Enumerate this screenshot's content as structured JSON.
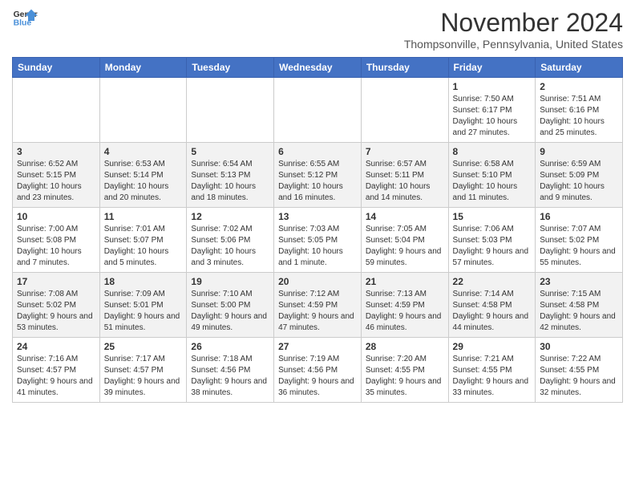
{
  "logo": {
    "line1": "General",
    "line2": "Blue"
  },
  "header": {
    "month": "November 2024",
    "location": "Thompsonville, Pennsylvania, United States"
  },
  "weekdays": [
    "Sunday",
    "Monday",
    "Tuesday",
    "Wednesday",
    "Thursday",
    "Friday",
    "Saturday"
  ],
  "weeks": [
    [
      {
        "day": "",
        "info": ""
      },
      {
        "day": "",
        "info": ""
      },
      {
        "day": "",
        "info": ""
      },
      {
        "day": "",
        "info": ""
      },
      {
        "day": "",
        "info": ""
      },
      {
        "day": "1",
        "info": "Sunrise: 7:50 AM\nSunset: 6:17 PM\nDaylight: 10 hours and 27 minutes."
      },
      {
        "day": "2",
        "info": "Sunrise: 7:51 AM\nSunset: 6:16 PM\nDaylight: 10 hours and 25 minutes."
      }
    ],
    [
      {
        "day": "3",
        "info": "Sunrise: 6:52 AM\nSunset: 5:15 PM\nDaylight: 10 hours and 23 minutes."
      },
      {
        "day": "4",
        "info": "Sunrise: 6:53 AM\nSunset: 5:14 PM\nDaylight: 10 hours and 20 minutes."
      },
      {
        "day": "5",
        "info": "Sunrise: 6:54 AM\nSunset: 5:13 PM\nDaylight: 10 hours and 18 minutes."
      },
      {
        "day": "6",
        "info": "Sunrise: 6:55 AM\nSunset: 5:12 PM\nDaylight: 10 hours and 16 minutes."
      },
      {
        "day": "7",
        "info": "Sunrise: 6:57 AM\nSunset: 5:11 PM\nDaylight: 10 hours and 14 minutes."
      },
      {
        "day": "8",
        "info": "Sunrise: 6:58 AM\nSunset: 5:10 PM\nDaylight: 10 hours and 11 minutes."
      },
      {
        "day": "9",
        "info": "Sunrise: 6:59 AM\nSunset: 5:09 PM\nDaylight: 10 hours and 9 minutes."
      }
    ],
    [
      {
        "day": "10",
        "info": "Sunrise: 7:00 AM\nSunset: 5:08 PM\nDaylight: 10 hours and 7 minutes."
      },
      {
        "day": "11",
        "info": "Sunrise: 7:01 AM\nSunset: 5:07 PM\nDaylight: 10 hours and 5 minutes."
      },
      {
        "day": "12",
        "info": "Sunrise: 7:02 AM\nSunset: 5:06 PM\nDaylight: 10 hours and 3 minutes."
      },
      {
        "day": "13",
        "info": "Sunrise: 7:03 AM\nSunset: 5:05 PM\nDaylight: 10 hours and 1 minute."
      },
      {
        "day": "14",
        "info": "Sunrise: 7:05 AM\nSunset: 5:04 PM\nDaylight: 9 hours and 59 minutes."
      },
      {
        "day": "15",
        "info": "Sunrise: 7:06 AM\nSunset: 5:03 PM\nDaylight: 9 hours and 57 minutes."
      },
      {
        "day": "16",
        "info": "Sunrise: 7:07 AM\nSunset: 5:02 PM\nDaylight: 9 hours and 55 minutes."
      }
    ],
    [
      {
        "day": "17",
        "info": "Sunrise: 7:08 AM\nSunset: 5:02 PM\nDaylight: 9 hours and 53 minutes."
      },
      {
        "day": "18",
        "info": "Sunrise: 7:09 AM\nSunset: 5:01 PM\nDaylight: 9 hours and 51 minutes."
      },
      {
        "day": "19",
        "info": "Sunrise: 7:10 AM\nSunset: 5:00 PM\nDaylight: 9 hours and 49 minutes."
      },
      {
        "day": "20",
        "info": "Sunrise: 7:12 AM\nSunset: 4:59 PM\nDaylight: 9 hours and 47 minutes."
      },
      {
        "day": "21",
        "info": "Sunrise: 7:13 AM\nSunset: 4:59 PM\nDaylight: 9 hours and 46 minutes."
      },
      {
        "day": "22",
        "info": "Sunrise: 7:14 AM\nSunset: 4:58 PM\nDaylight: 9 hours and 44 minutes."
      },
      {
        "day": "23",
        "info": "Sunrise: 7:15 AM\nSunset: 4:58 PM\nDaylight: 9 hours and 42 minutes."
      }
    ],
    [
      {
        "day": "24",
        "info": "Sunrise: 7:16 AM\nSunset: 4:57 PM\nDaylight: 9 hours and 41 minutes."
      },
      {
        "day": "25",
        "info": "Sunrise: 7:17 AM\nSunset: 4:57 PM\nDaylight: 9 hours and 39 minutes."
      },
      {
        "day": "26",
        "info": "Sunrise: 7:18 AM\nSunset: 4:56 PM\nDaylight: 9 hours and 38 minutes."
      },
      {
        "day": "27",
        "info": "Sunrise: 7:19 AM\nSunset: 4:56 PM\nDaylight: 9 hours and 36 minutes."
      },
      {
        "day": "28",
        "info": "Sunrise: 7:20 AM\nSunset: 4:55 PM\nDaylight: 9 hours and 35 minutes."
      },
      {
        "day": "29",
        "info": "Sunrise: 7:21 AM\nSunset: 4:55 PM\nDaylight: 9 hours and 33 minutes."
      },
      {
        "day": "30",
        "info": "Sunrise: 7:22 AM\nSunset: 4:55 PM\nDaylight: 9 hours and 32 minutes."
      }
    ]
  ]
}
